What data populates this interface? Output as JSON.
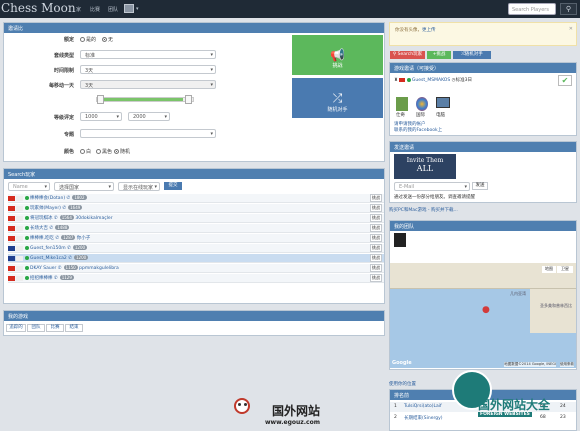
{
  "nav": {
    "brand": "Chess Moon",
    "links": [
      "家",
      "比赛",
      "团队"
    ],
    "search_placeholder": "Search Players"
  },
  "create": {
    "title": "邀请比",
    "rated_label": "额定",
    "rated_options": [
      "是的",
      "无"
    ],
    "variant_label": "套线类型",
    "variant_value": "标准",
    "time_label": "时间限制",
    "time_value": "3天",
    "per_move_label": "每移动一天",
    "per_move_value": "3天",
    "rating_label": "等级评定",
    "rating_min": "1000",
    "rating_max": "2000",
    "opponent_label": "专题",
    "color_label": "颜色",
    "color_options": [
      "白",
      "黑色",
      "随机"
    ],
    "challenge_btn": "挑战",
    "random_btn": "随机对手"
  },
  "players": {
    "title": "Search玩家",
    "name_placeholder": "Name",
    "country_value": "选择国家",
    "status_value": "显示在线玩家",
    "submit_label": "提交",
    "challenge_label": "挑战",
    "rows": [
      {
        "name": "棒棒棒会(Dotan)",
        "rating": "1802",
        "note": ""
      },
      {
        "name": "玩家帅(Mayer)",
        "rating": "1649",
        "note": ""
      },
      {
        "name": "将冠玩棋冰",
        "rating": "1564",
        "note": "30dokikalmaçler"
      },
      {
        "name": "长场大吉",
        "rating": "1488",
        "note": ""
      },
      {
        "name": "棒棒棒,吃吃",
        "rating": "1287",
        "note": "你小子"
      },
      {
        "name": "Guest_fen150m",
        "rating": "1200",
        "note": ""
      },
      {
        "name": "Guest_Mike1ca2",
        "rating": "1200",
        "note": ""
      },
      {
        "name": "DKAY Sauer",
        "rating": "1150",
        "note": "ppmmakgulelibra"
      },
      {
        "name": "招招棒棒棒",
        "rating": "1129",
        "note": ""
      }
    ]
  },
  "my_games": {
    "title": "我的游戏",
    "tabs": [
      "追踪的",
      "团队",
      "比赛",
      "结束"
    ]
  },
  "right": {
    "notice": "你没有头像",
    "notice_link": "更上传",
    "tab_search": "Search玩家",
    "tab_challenge": "挑战",
    "tab_random": "随机对手",
    "invites_title": "游戏邀请（可接受）",
    "invite_player": "Guest_MSMAKOS",
    "invite_days": "标准3日",
    "platforms": [
      "仕奇",
      "国际",
      "电脑"
    ],
    "facebook_text": "请申请我的帐户",
    "facebook_link": "联系的我的Facebook上",
    "invite_them_title": "发送邀请",
    "invite_them_line1": "Invite Them",
    "invite_them_line2": "ALL",
    "email_placeholder": "E-Mail",
    "send_label": "发送",
    "send_note": "通过发送一份部分给朋友。调查邀请提醒",
    "pc_link": "购买PC和Mac游戏 - 购买并下载...",
    "team_title": "我的团队",
    "map_credit": "地图数据©2014 Google, INEGI",
    "terms": "使用条款",
    "map_tab1": "地图",
    "map_tab2": "卫星",
    "region1": "几内亚湾",
    "region2": "圣多美和普林西比",
    "location_link": "使用你的位置",
    "top_title": "排名前",
    "top_rows": [
      {
        "rank": "1",
        "name": "TulsiQrsi(ato)Laif",
        "a": "68",
        "b": "24"
      },
      {
        "rank": "2",
        "name": "长期结束(Sinergy)",
        "a": "68",
        "b": "23"
      }
    ]
  },
  "watermark": {
    "cn": "国外网站",
    "url": "www.egouz.com",
    "cn2": "国外网站大全",
    "en": "FOREIGN WEBSITES"
  }
}
